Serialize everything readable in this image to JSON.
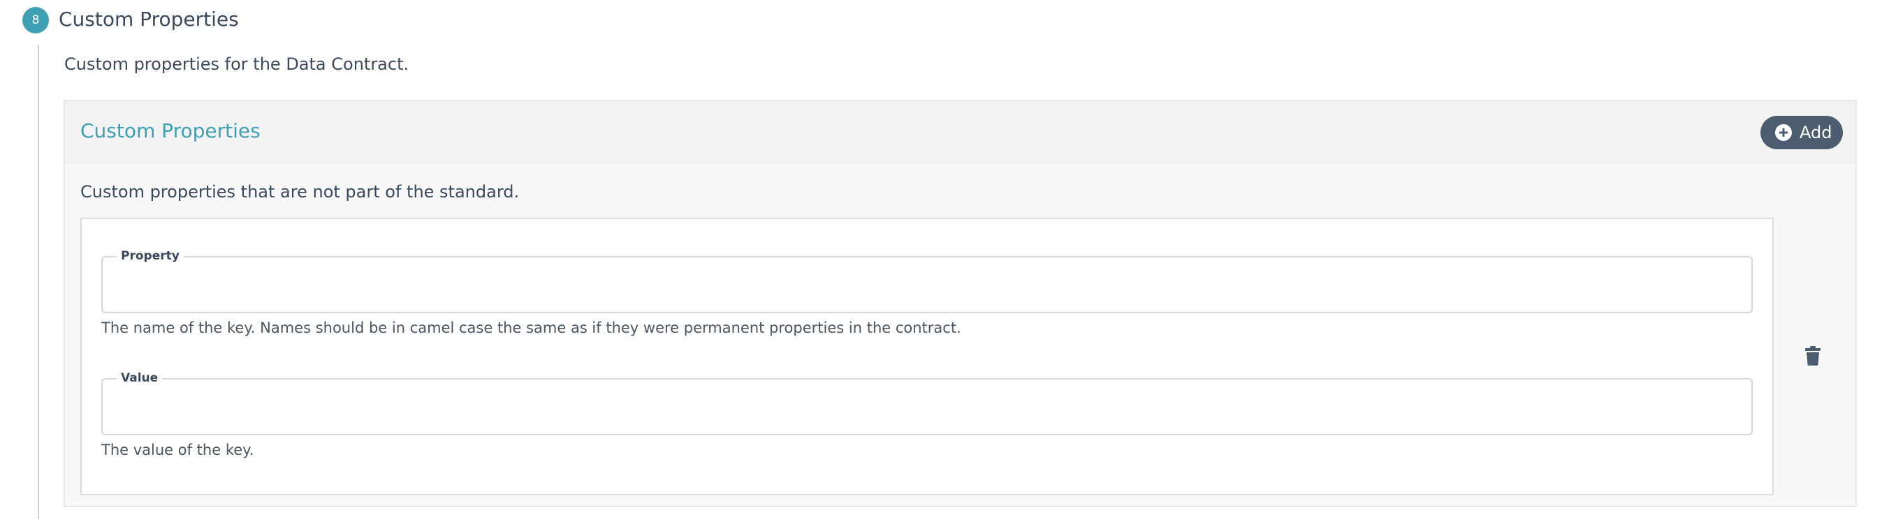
{
  "section": {
    "step_number": "8",
    "title": "Custom Properties",
    "description": "Custom properties for the Data Contract."
  },
  "panel": {
    "title": "Custom Properties",
    "add_button_label": "Add",
    "add_icon": "plus-circle-icon",
    "description": "Custom properties that are not part of the standard."
  },
  "item": {
    "property": {
      "label": "Property",
      "value": "",
      "help": "The name of the key. Names should be in camel case the same as if they were permanent properties in the contract."
    },
    "value": {
      "label": "Value",
      "value": "",
      "help": "The value of the key."
    },
    "delete_icon": "trash-icon"
  },
  "colors": {
    "accent": "#3f9fb3",
    "button_bg": "#4c5d70",
    "text": "#3a4a5c"
  }
}
